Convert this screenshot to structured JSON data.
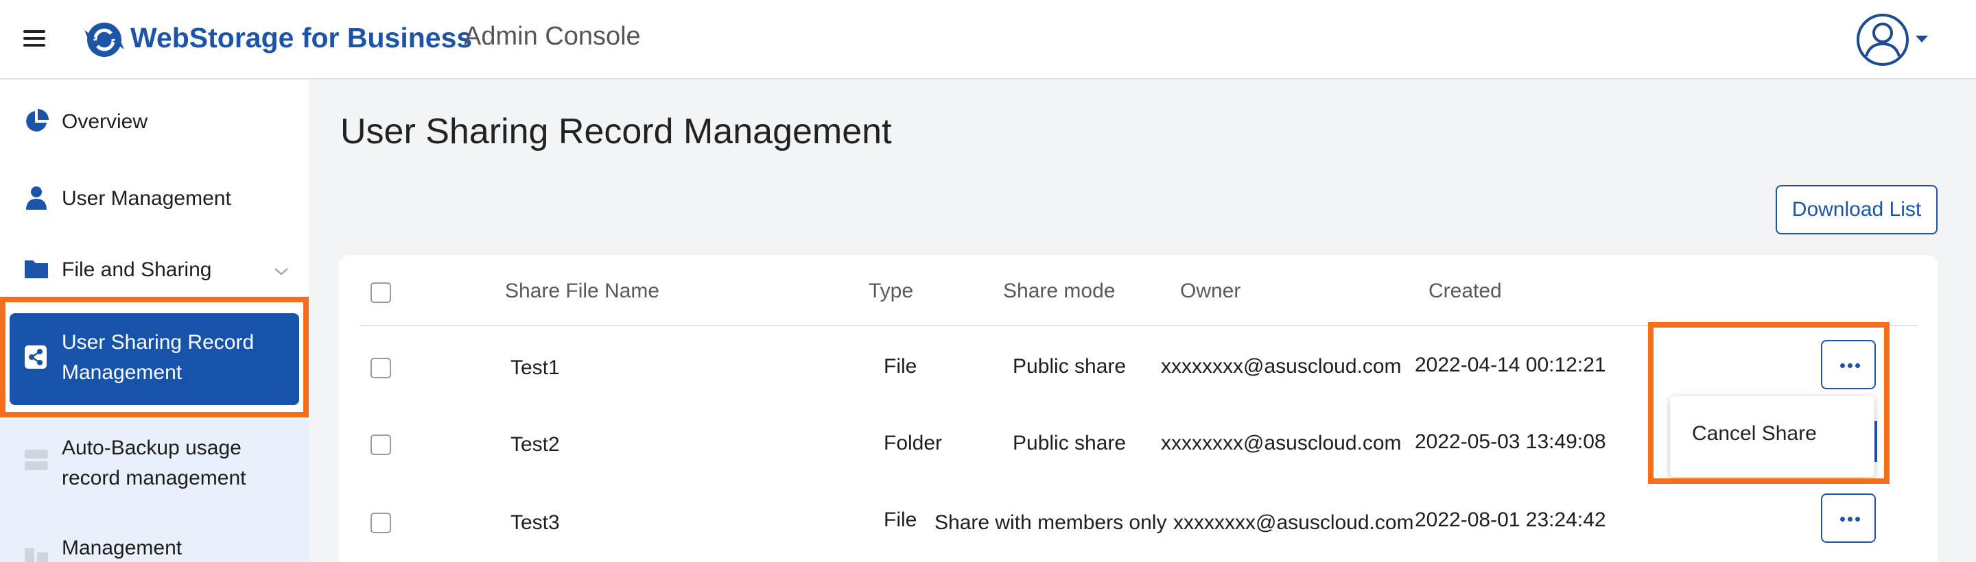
{
  "header": {
    "brand": "WebStorage for Business",
    "subtitle": "Admin Console"
  },
  "icons": {
    "menu": "hamburger-menu-icon",
    "logo": "webstorage-logo-icon",
    "account": "user-avatar-icon",
    "overview": "pie-chart-icon",
    "users": "person-icon",
    "files": "folder-icon",
    "share": "share-icon",
    "backup": "server-icon"
  },
  "sidebar": {
    "items": [
      {
        "label": "Overview"
      },
      {
        "label": "User Management"
      },
      {
        "label": "File and Sharing"
      },
      {
        "label_line1": "User Sharing Record",
        "label_line2": "Management"
      },
      {
        "label_line1": "Auto-Backup usage",
        "label_line2": "record management"
      },
      {
        "label": "Management"
      }
    ]
  },
  "main": {
    "title": "User Sharing Record Management",
    "download_button": "Download List",
    "columns": [
      "Share File Name",
      "Type",
      "Share mode",
      "Owner",
      "Created"
    ],
    "rows": [
      {
        "name": "Test1",
        "type": "File",
        "mode": "Public share",
        "owner": "xxxxxxxx@asuscloud.com",
        "created": "2022-04-14 00:12:21"
      },
      {
        "name": "Test2",
        "type": "Folder",
        "mode": "Public share",
        "owner": "xxxxxxxx@asuscloud.com",
        "created": "2022-05-03 13:49:08"
      },
      {
        "name": "Test3",
        "type": "File",
        "mode": "Share with members only",
        "owner": "xxxxxxxx@asuscloud.com",
        "created": "2022-08-01 23:24:42"
      }
    ],
    "menu": {
      "cancel_share": "Cancel Share"
    }
  },
  "colors": {
    "brand": "#1c55a8",
    "active_nav": "#1753a8",
    "highlight": "#f26f1f",
    "background": "#f3f4f6"
  }
}
